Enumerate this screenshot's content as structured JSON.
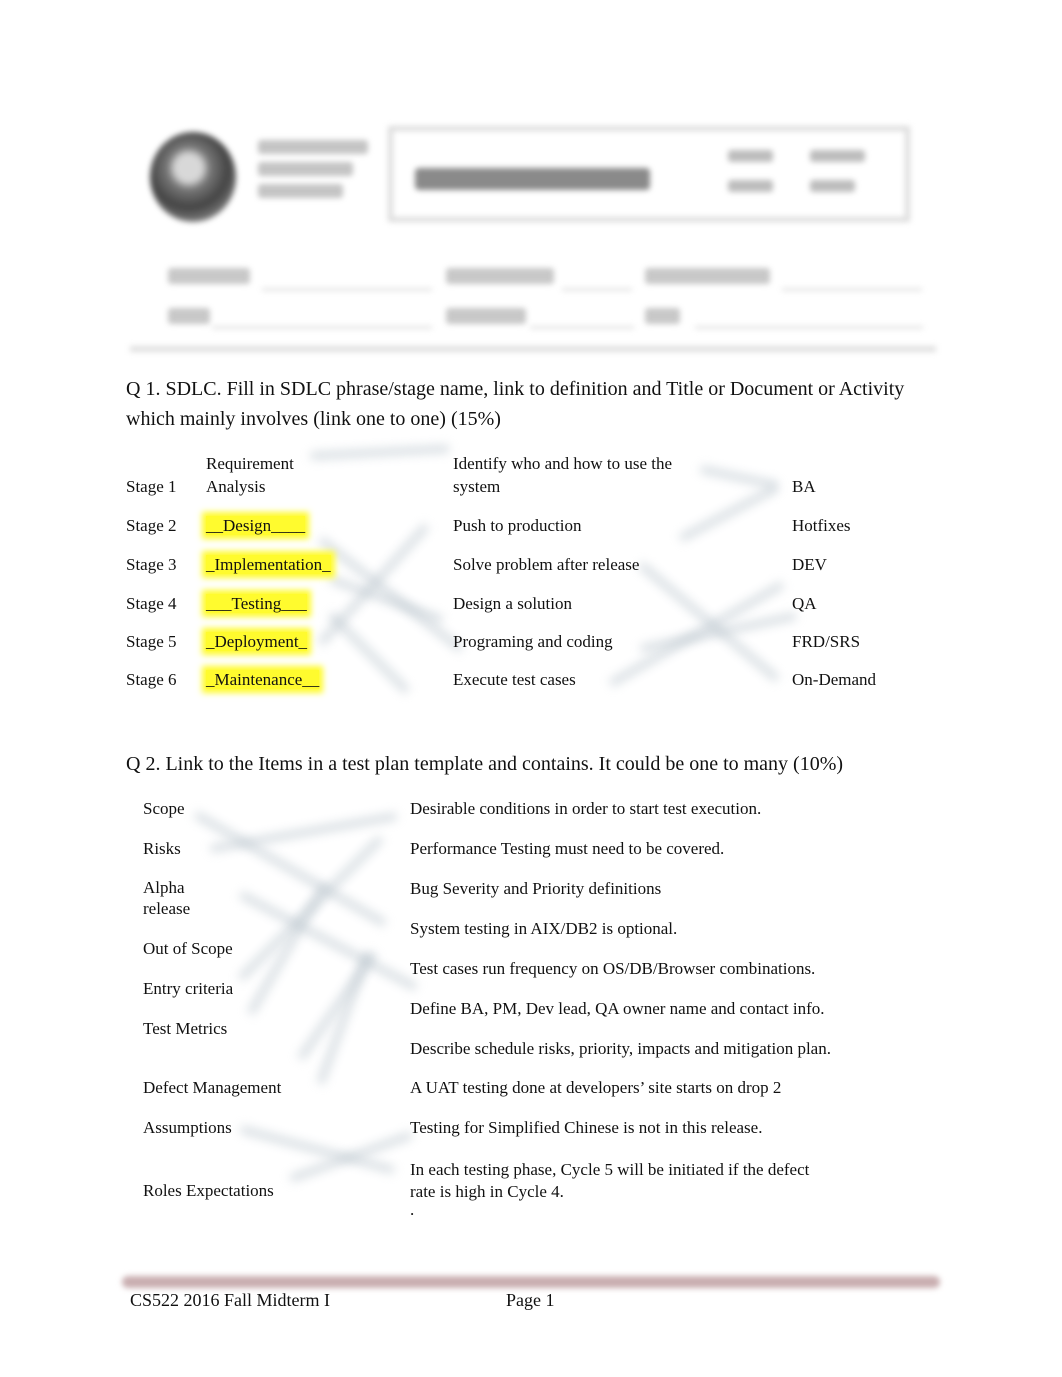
{
  "header": {
    "note": "blurred",
    "exam_title_visible": false
  },
  "q1": {
    "title_line1": "Q 1. SDLC. Fill in SDLC phrase/stage name, link to definition and Title or Document or Activity",
    "title_line2": "which mainly involves (link one to one) (15%)",
    "stages": [
      {
        "label": "Stage 1",
        "answer_line1": "Requirement",
        "answer_line2": "Analysis",
        "highlighted": false
      },
      {
        "label": "Stage 2",
        "answer": "__Design____",
        "highlighted": true
      },
      {
        "label": "Stage 3",
        "answer": "_Implementation_",
        "highlighted": true
      },
      {
        "label": "Stage 4",
        "answer": "___Testing___",
        "highlighted": true
      },
      {
        "label": "Stage 5",
        "answer": "_Deployment_",
        "highlighted": true
      },
      {
        "label": "Stage 6",
        "answer": "_Maintenance__",
        "highlighted": true
      }
    ],
    "definitions": [
      {
        "line1": "Identify who and how to use the",
        "line2": "system"
      },
      {
        "text": "Push to production"
      },
      {
        "text": "Solve problem after release"
      },
      {
        "text": "Design a solution"
      },
      {
        "text": "Programing and coding"
      },
      {
        "text": "Execute test cases"
      }
    ],
    "roles": [
      "BA",
      "Hotfixes",
      "DEV",
      "QA",
      "FRD/SRS",
      "On-Demand"
    ],
    "highlight_color": "#fffb2e"
  },
  "q2": {
    "title": "Q 2. Link to the Items in a test plan template and contains. It could be one to many (10%)",
    "items": [
      {
        "text": "Scope"
      },
      {
        "text": "Risks"
      },
      {
        "line1": "Alpha",
        "line2": "release"
      },
      {
        "text": "Out of Scope"
      },
      {
        "text": "Entry criteria"
      },
      {
        "text": "Test Metrics"
      },
      {
        "text": "Defect Management"
      },
      {
        "text": "Assumptions"
      },
      {
        "text": "Roles Expectations"
      }
    ],
    "descriptions": [
      {
        "text": "Desirable conditions in order to start test execution."
      },
      {
        "text": "Performance Testing must need to be covered."
      },
      {
        "text": "Bug Severity and Priority definitions"
      },
      {
        "text": "System testing in AIX/DB2 is optional."
      },
      {
        "text": "Test cases run frequency on OS/DB/Browser combinations."
      },
      {
        "text": "Define BA, PM, Dev lead, QA owner name and contact info."
      },
      {
        "text": "Describe schedule risks, priority, impacts and mitigation plan."
      },
      {
        "text": "A UAT testing done at developers’ site starts on drop 2"
      },
      {
        "text": "Testing for Simplified Chinese is not in this release."
      },
      {
        "line1": "In each testing phase, Cycle 5 will be initiated if the defect",
        "line2": "rate is high in Cycle 4.",
        "line3": "."
      }
    ]
  },
  "footer": {
    "course": "CS522 2016 Fall Midterm I",
    "page": "Page 1",
    "rule_color": "#c9aeb0"
  }
}
